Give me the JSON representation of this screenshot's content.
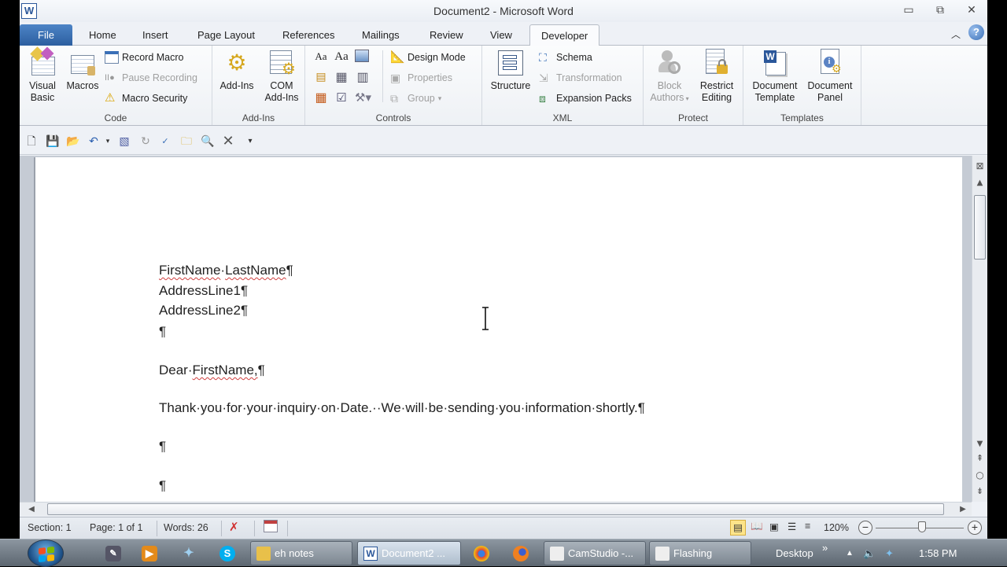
{
  "window": {
    "title": "Document2 - Microsoft Word",
    "app_icon": "W",
    "controls": {
      "minimize": "▭",
      "restore": "⧉",
      "close": "✕"
    }
  },
  "tabs": [
    {
      "label": "File"
    },
    {
      "label": "Home"
    },
    {
      "label": "Insert"
    },
    {
      "label": "Page Layout"
    },
    {
      "label": "References"
    },
    {
      "label": "Mailings"
    },
    {
      "label": "Review"
    },
    {
      "label": "View"
    },
    {
      "label": "Developer",
      "active": true
    }
  ],
  "ribbon": {
    "minimize_icon": "︿",
    "help_icon": "?",
    "groups": {
      "code": {
        "label": "Code",
        "visual_basic": "Visual Basic",
        "macros": "Macros",
        "record_macro": "Record Macro",
        "pause_recording": "Pause Recording",
        "macro_security": "Macro Security"
      },
      "addins": {
        "label": "Add-Ins",
        "addins": "Add-Ins",
        "com_addins_1": "COM",
        "com_addins_2": "Add-Ins"
      },
      "controls": {
        "label": "Controls",
        "rich_text": "Aa",
        "plain_text": "Aa",
        "design_mode": "Design Mode",
        "properties": "Properties",
        "group": "Group"
      },
      "xml": {
        "label": "XML",
        "structure": "Structure",
        "schema": "Schema",
        "transformation": "Transformation",
        "expansion_packs": "Expansion Packs"
      },
      "protect": {
        "label": "Protect",
        "block_authors_1": "Block",
        "block_authors_2": "Authors",
        "restrict_editing_1": "Restrict",
        "restrict_editing_2": "Editing"
      },
      "templates": {
        "label": "Templates",
        "document_template_1": "Document",
        "document_template_2": "Template",
        "document_panel_1": "Document",
        "document_panel_2": "Panel"
      }
    }
  },
  "document": {
    "lines": [
      {
        "parts": [
          {
            "t": "FirstName",
            "sq": true
          },
          {
            "t": "·"
          },
          {
            "t": "LastName",
            "sq": true
          },
          {
            "t": "¶"
          }
        ]
      },
      {
        "parts": [
          {
            "t": "AddressLine1¶"
          }
        ]
      },
      {
        "parts": [
          {
            "t": "AddressLine2¶"
          }
        ]
      },
      {
        "parts": [
          {
            "t": "¶"
          }
        ]
      },
      {
        "parts": [
          {
            "t": "Dear·"
          },
          {
            "t": "FirstName,",
            "sq": true
          },
          {
            "t": "¶"
          }
        ]
      },
      {
        "parts": [
          {
            "t": "Thank·you·for·your·inquiry·on·Date.··We·will·be·sending·you·information·shortly.¶"
          }
        ]
      },
      {
        "parts": [
          {
            "t": "¶"
          }
        ]
      },
      {
        "parts": [
          {
            "t": "¶"
          }
        ]
      }
    ]
  },
  "statusbar": {
    "section": "Section: 1",
    "page": "Page: 1 of 1",
    "words": "Words: 26",
    "zoom": "120%",
    "zoom_level_percent": 120
  },
  "taskbar": {
    "tasks": [
      {
        "label": "eh notes"
      },
      {
        "label": "Document2 ...",
        "active": true
      },
      {
        "label": "CamStudio -..."
      },
      {
        "label": "Flashing"
      }
    ],
    "toolbar_label": "Desktop",
    "chevron": "»",
    "clock": "1:58 PM"
  }
}
